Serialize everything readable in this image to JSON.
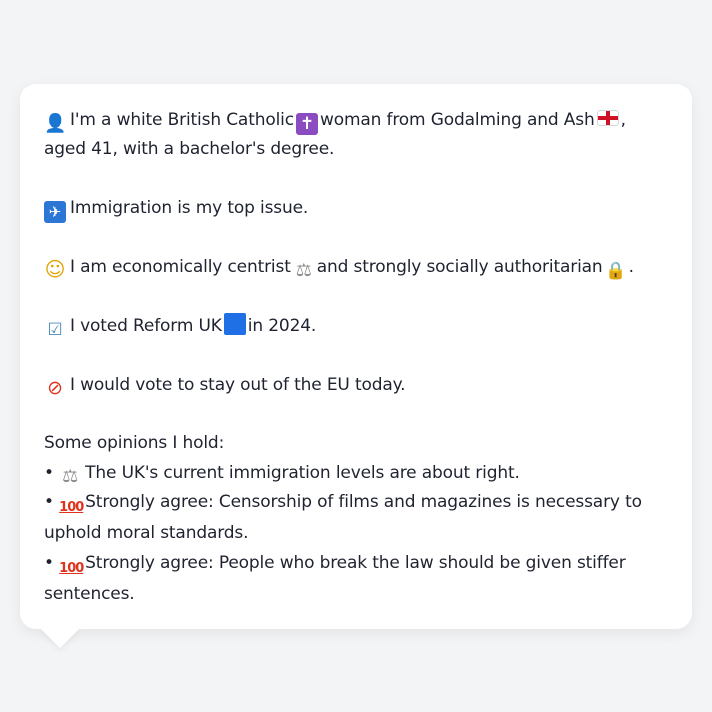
{
  "colors": {
    "background": "#f3f4f6",
    "bubble": "#ffffff",
    "text": "#1f2330"
  },
  "message": {
    "p1": {
      "icon": "person-silhouette-icon",
      "text_a": "I'm a white British Catholic",
      "cross_icon": "latin-cross-icon",
      "text_b": "woman from Godalming and Ash",
      "flag_icon": "england-flag-icon",
      "text_c": ", aged 41, with a bachelor's degree."
    },
    "p2": {
      "icon": "passport-control-icon",
      "text": "Immigration is my top issue."
    },
    "p3": {
      "icon": "thinking-face-icon",
      "text_a": "I am economically centrist",
      "scales_icon": "balance-scale-icon",
      "text_b": "and strongly socially authoritarian",
      "lock_icon": "locked-padlock-icon",
      "text_c": "."
    },
    "p4": {
      "icon": "ballot-box-icon",
      "text_a": "I voted Reform UK",
      "square_icon": "blue-square-icon",
      "text_b": "in 2024."
    },
    "p5": {
      "icon": "no-entry-sign-icon",
      "text": "I would vote to stay out of the EU today."
    },
    "opinions_heading": "Some opinions I hold:",
    "opinions": [
      {
        "bullet": "•",
        "icon": "balance-scale-icon",
        "text": "The UK's current immigration levels are about right."
      },
      {
        "bullet": "•",
        "icon": "hundred-points-icon",
        "text": "Strongly agree: Censorship of films and magazines is necessary to uphold moral standards."
      },
      {
        "bullet": "•",
        "icon": "hundred-points-icon",
        "text": "Strongly agree: People who break the law should be given stiffer sentences."
      }
    ]
  }
}
